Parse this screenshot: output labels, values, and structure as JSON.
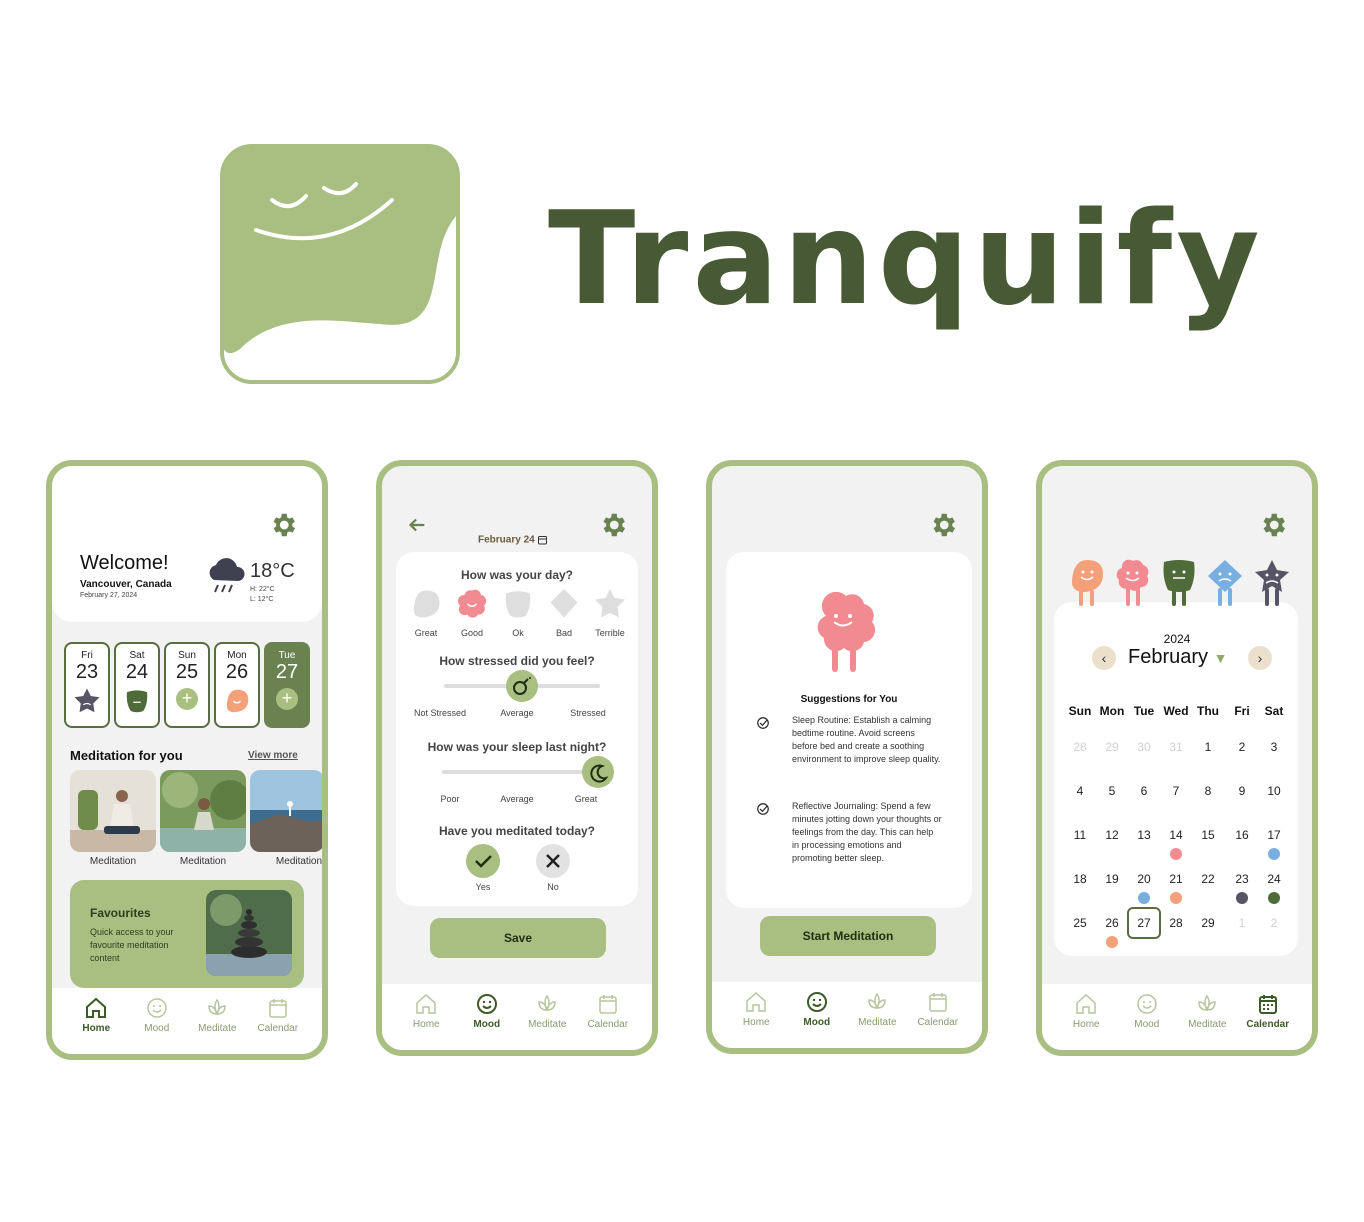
{
  "brand": {
    "name": "Tranquify",
    "primary_color": "#a9bf82",
    "dark_color": "#475a35"
  },
  "nav": {
    "home": "Home",
    "mood": "Mood",
    "meditate": "Meditate",
    "calendar": "Calendar"
  },
  "home_screen": {
    "welcome": "Welcome!",
    "location": "Vancouver, Canada",
    "date": "February 27, 2024",
    "temperature": "18°C",
    "high": "H: 22°C",
    "low": "L: 12°C",
    "days": [
      {
        "name": "Fri",
        "num": "23",
        "mood": "terrible"
      },
      {
        "name": "Sat",
        "num": "24",
        "mood": "ok"
      },
      {
        "name": "Sun",
        "num": "25",
        "mood": "add"
      },
      {
        "name": "Mon",
        "num": "26",
        "mood": "great"
      },
      {
        "name": "Tue",
        "num": "27",
        "mood": "add"
      }
    ],
    "meditation_title": "Meditation for you",
    "view_more": "View more",
    "thumbs": [
      "Meditation",
      "Meditation",
      "Meditation"
    ],
    "favourites_title": "Favourites",
    "favourites_desc": "Quick access to your favourite meditation content"
  },
  "mood_screen": {
    "date": "February 24",
    "q1": "How was your day?",
    "moods": [
      "Great",
      "Good",
      "Ok",
      "Bad",
      "Terrible"
    ],
    "q2": "How stressed did you feel?",
    "stress_labels": [
      "Not Stressed",
      "Average",
      "Stressed"
    ],
    "stress_level": 0.5,
    "q3": "How was your sleep last night?",
    "sleep_labels": [
      "Poor",
      "Average",
      "Great"
    ],
    "sleep_level": 1.0,
    "q4": "Have you meditated today?",
    "yes": "Yes",
    "no": "No",
    "save": "Save"
  },
  "suggest_screen": {
    "title": "Suggestions for You",
    "items": [
      "Sleep Routine: Establish a calming bedtime routine. Avoid screens before bed and create a soothing environment to improve sleep quality.",
      "Reflective Journaling: Spend a few minutes jotting down your thoughts or feelings from the day. This can help in processing emotions and promoting better sleep."
    ],
    "button": "Start Meditation"
  },
  "calendar_screen": {
    "year": "2024",
    "month": "February",
    "weekdays": [
      "Sun",
      "Mon",
      "Tue",
      "Wed",
      "Thu",
      "Fri",
      "Sat"
    ],
    "weeks": [
      [
        "28",
        "29",
        "30",
        "31",
        "1",
        "2",
        "3"
      ],
      [
        "4",
        "5",
        "6",
        "7",
        "8",
        "9",
        "10"
      ],
      [
        "11",
        "12",
        "13",
        "14",
        "15",
        "16",
        "17"
      ],
      [
        "18",
        "19",
        "20",
        "21",
        "22",
        "23",
        "24"
      ],
      [
        "25",
        "26",
        "27",
        "28",
        "29",
        "1",
        "2"
      ]
    ],
    "today": "27",
    "mood_colors": {
      "great": "#f4a07a",
      "good": "#f28b91",
      "ok": "#4f6b3a",
      "bad": "#79aee0",
      "terrible": "#565465"
    }
  }
}
